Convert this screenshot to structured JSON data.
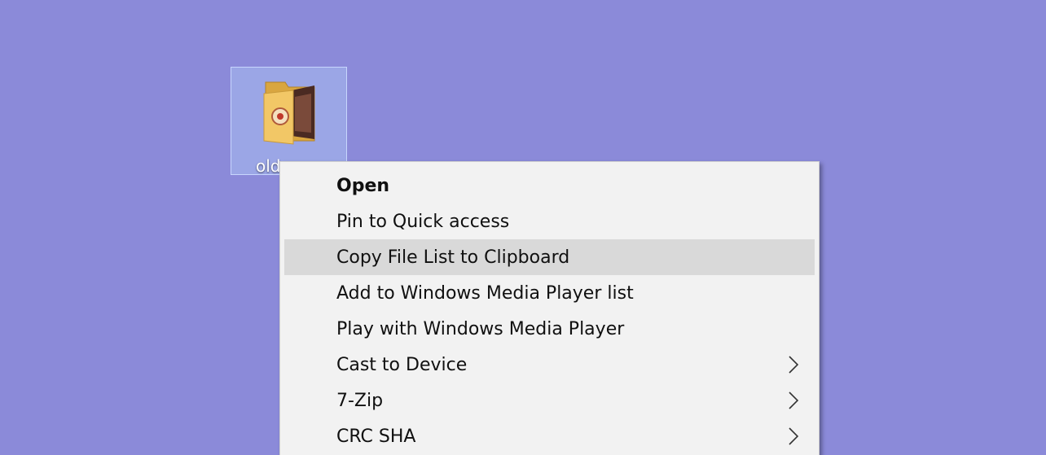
{
  "desktop": {
    "background_color": "#8b8ad9",
    "selected_icon": {
      "label": "old",
      "icon": "folder-icon"
    }
  },
  "context_menu": {
    "items": [
      {
        "label": "Open",
        "bold": true,
        "has_submenu": false,
        "highlighted": false
      },
      {
        "label": "Pin to Quick access",
        "bold": false,
        "has_submenu": false,
        "highlighted": false
      },
      {
        "label": "Copy File List to Clipboard",
        "bold": false,
        "has_submenu": false,
        "highlighted": true
      },
      {
        "label": "Add to Windows Media Player list",
        "bold": false,
        "has_submenu": false,
        "highlighted": false
      },
      {
        "label": "Play with Windows Media Player",
        "bold": false,
        "has_submenu": false,
        "highlighted": false
      },
      {
        "label": "Cast to Device",
        "bold": false,
        "has_submenu": true,
        "highlighted": false
      },
      {
        "label": "7-Zip",
        "bold": false,
        "has_submenu": true,
        "highlighted": false
      },
      {
        "label": "CRC SHA",
        "bold": false,
        "has_submenu": true,
        "highlighted": false
      }
    ],
    "highlight_color": "#d9d9d9",
    "background_color": "#f2f2f2"
  }
}
